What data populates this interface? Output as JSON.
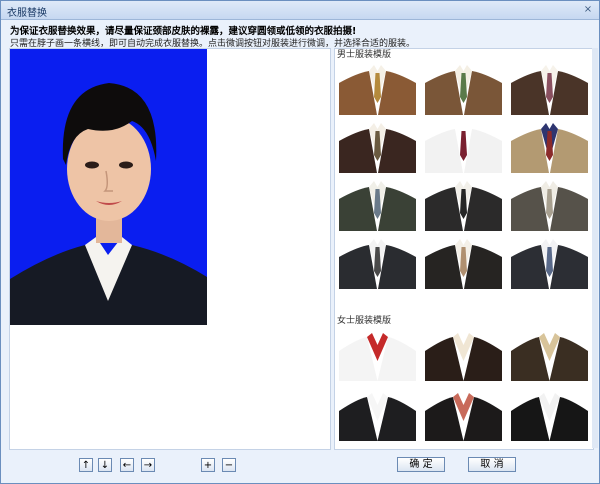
{
  "window": {
    "title": "衣服替换",
    "close_glyph": "×"
  },
  "instructions": {
    "line1": "为保证衣服替换效果，请尽量保证颈部皮肤的裸露，建议穿圆领或低领的衣服拍摄!",
    "line2": "只需在脖子画一条横线，即可自动完成衣服替换。点击微调按钮对服装进行微调，并选择合适的服装。"
  },
  "sections": {
    "male_label": "男士服装模版",
    "female_label": "女士服装模版"
  },
  "male_templates": [
    {
      "suit": "#8a5a35",
      "shirt": "#f5f0e6",
      "tie": "#b58a3c"
    },
    {
      "suit": "#7a5638",
      "shirt": "#f4efe4",
      "tie": "#5a7a4a"
    },
    {
      "suit": "#4a3428",
      "shirt": "#f6f2ea",
      "tie": "#8a5060"
    },
    {
      "suit": "#3a2620",
      "shirt": "#f4efe6",
      "tie": "#6a5a40"
    },
    {
      "suit": "#f2f2f2",
      "shirt": "#ffffff",
      "tie": "#7a2030"
    },
    {
      "suit": "#b39a72",
      "shirt": "#2e3570",
      "tie": "#8a2a2a"
    },
    {
      "suit": "#3a4136",
      "shirt": "#f0efe8",
      "tie": "#6a7a8a"
    },
    {
      "suit": "#2b2a2a",
      "shirt": "#f2f0ea",
      "tie": "#262626"
    },
    {
      "suit": "#56524a",
      "shirt": "#efece4",
      "tie": "#a8a090"
    },
    {
      "suit": "#2a2c30",
      "shirt": "#f3f3f3",
      "tie": "#4a4a4a"
    },
    {
      "suit": "#262422",
      "shirt": "#f4f0e8",
      "tie": "#b09070"
    },
    {
      "suit": "#2c2e34",
      "shirt": "#f2f2f4",
      "tie": "#5a6a8a"
    }
  ],
  "female_templates": [
    {
      "outer": "#f4f4f4",
      "inner": "#c52a2a"
    },
    {
      "outer": "#2a1e18",
      "inner": "#f0e6d4"
    },
    {
      "outer": "#3a2e22",
      "inner": "#d8c49a"
    },
    {
      "outer": "#1e1e20",
      "inner": "#f6f6f6"
    },
    {
      "outer": "#1c1a1a",
      "inner": "#c86a5a"
    },
    {
      "outer": "#161616",
      "inner": "#f2f2f2"
    }
  ],
  "toolbar": {
    "up": "↑",
    "down": "↓",
    "left": "←",
    "right": "→",
    "zoom_in": "+",
    "zoom_out": "−",
    "confirm": "确 定",
    "cancel": "取 消"
  },
  "colors": {
    "photo_background": "#0a1ef0",
    "window_bg": "#eaf1fb",
    "accent": "#6b8fbf"
  }
}
